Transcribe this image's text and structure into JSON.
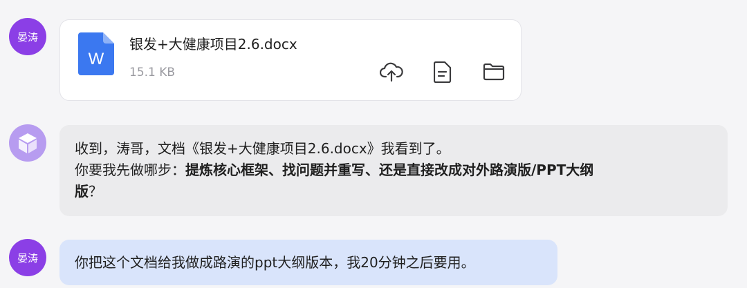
{
  "messages": {
    "user_file": {
      "avatar_label": "晏涛",
      "file_name": "银发+大健康项目2.6.docx",
      "file_size": "15.1 KB",
      "file_type_letter": "W",
      "actions": [
        "cloud-upload-icon",
        "document-icon",
        "folder-icon"
      ]
    },
    "bot_reply": {
      "line1": "收到，涛哥，文档《银发+大健康项目2.6.docx》我看到了。",
      "line2_prefix": "你要我先做哪步：",
      "line2_bold": "提炼核心框架、找问题并重写、还是直接改成对外路演版/PPT大纲",
      "line3_bold": "版",
      "line3_suffix": "？"
    },
    "user_message": {
      "avatar_label": "晏涛",
      "text": "你把这个文档给我做成路演的ppt大纲版本，我20分钟之后要用。"
    }
  },
  "colors": {
    "user_avatar": "#8b3fe6",
    "bot_avatar": "#b79cf0",
    "word_icon": "#3b78f0",
    "user_bubble": "#d9e4fb",
    "bot_bubble": "#ebebed"
  }
}
